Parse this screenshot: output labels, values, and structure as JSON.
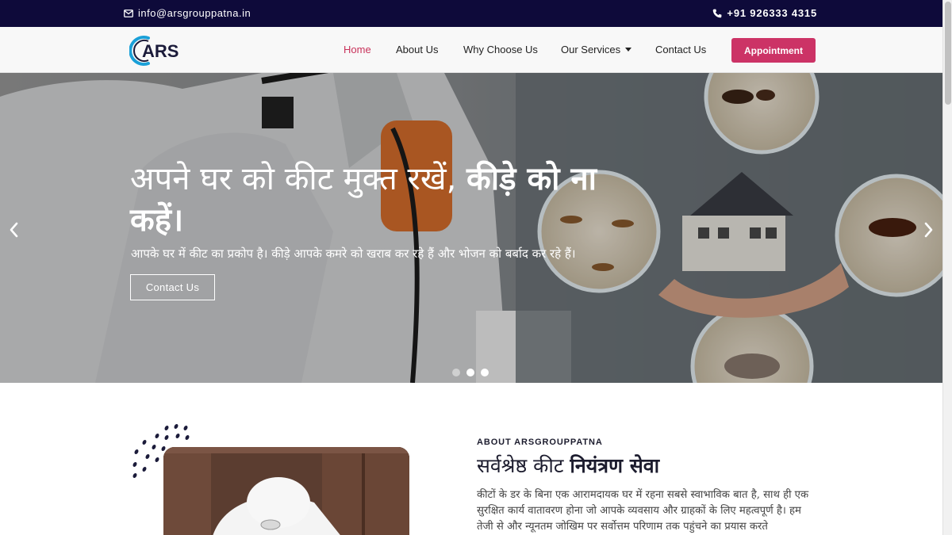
{
  "topbar": {
    "email": "info@arsgrouppatna.in",
    "phone": "+91 926333 4315",
    "email_icon": "envelope-icon",
    "phone_icon": "phone-icon",
    "bg_color": "#0e0a3a"
  },
  "header": {
    "logo_text": "ARS",
    "nav": [
      {
        "label": "Home",
        "active": true
      },
      {
        "label": "About Us"
      },
      {
        "label": "Why Choose Us"
      },
      {
        "label": "Our Services",
        "dropdown": true
      },
      {
        "label": "Contact Us"
      }
    ],
    "cta": "Appointment",
    "accent_color": "#cc3366"
  },
  "hero": {
    "title_regular": "अपने घर को कीट मुक्त रखें, ",
    "title_bold": "कीड़े को ना कहें।",
    "subtitle": "आपके घर में कीट का प्रकोप है। कीड़े आपके कमरे को खराब कर रहे हैं और भोजन को बर्बाद कर रहे हैं।",
    "button": "Contact Us",
    "prev_icon": "chevron-left-icon",
    "next_icon": "chevron-right-icon",
    "slides": 3,
    "active_slide": 2
  },
  "about": {
    "kicker": "ABOUT ARSGROUPPATNA",
    "title_regular": "सर्वश्रेष्ठ कीट ",
    "title_bold": "नियंत्रण सेवा",
    "text": "कीटों के डर के बिना एक आरामदायक घर में रहना सबसे स्वाभाविक बात है, साथ ही एक सुरक्षित कार्य वातावरण होना जो आपके व्यवसाय और ग्राहकों के लिए महत्वपूर्ण है। हम तेजी से और न्यूनतम जोखिम पर सर्वोत्तम परिणाम तक पहुंचने का प्रयास करते"
  }
}
